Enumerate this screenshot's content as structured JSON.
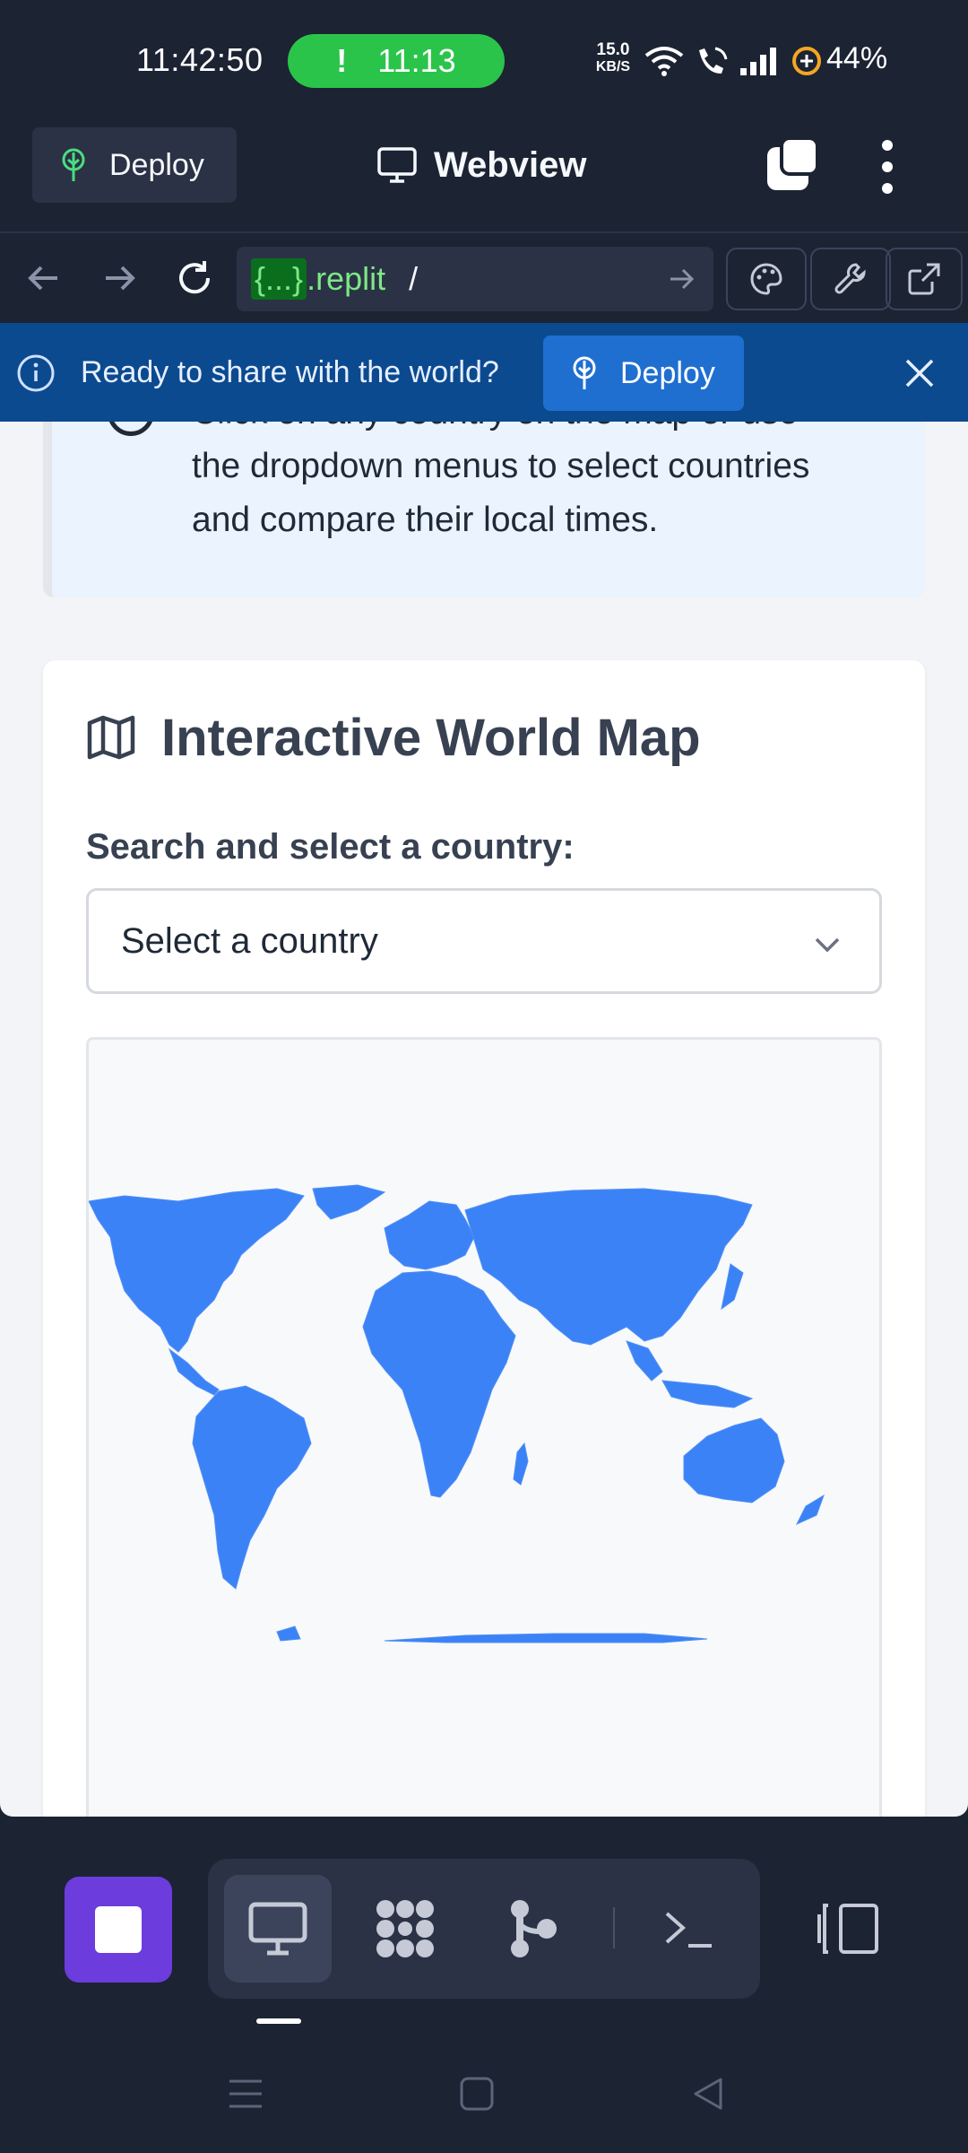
{
  "status_bar": {
    "time": "11:42:50",
    "call_timer": "11:13",
    "call_alert": "!",
    "net_speed_value": "15.0",
    "net_speed_unit": "KB/S",
    "battery_percent": "44%"
  },
  "app_header": {
    "deploy_label": "Deploy",
    "title": "Webview"
  },
  "browser": {
    "url_host": "{...}",
    "url_domain": ".replit",
    "url_path": "/"
  },
  "banner": {
    "message": "Ready to share with the world?",
    "deploy_label": "Deploy"
  },
  "page": {
    "instructions_line1": "Click on any country on the map or use",
    "instructions_line2": "the dropdown menus to select countries",
    "instructions_line3": "and compare their local times.",
    "map_title": "Interactive World Map",
    "search_label": "Search and select a country:",
    "select_value": "Select a country"
  },
  "colors": {
    "map_fill": "#3b82f6",
    "banner_bg": "#0c4a8f",
    "stop_button": "#6c3cdc",
    "call_pill": "#2bc44a"
  },
  "icons": {
    "deploy": "deploy-tree-icon",
    "webview": "monitor-icon",
    "tabs": "tabs-icon",
    "menu": "kebab-menu-icon",
    "back": "arrow-left-icon",
    "forward": "arrow-right-icon",
    "reload": "reload-icon",
    "go": "arrow-right-icon",
    "palette": "palette-icon",
    "devtools": "wrench-icon",
    "open_external": "external-link-icon",
    "info": "info-icon",
    "close": "close-icon",
    "map": "map-icon",
    "chevron": "chevron-down-icon",
    "stop": "stop-icon",
    "webview_pane": "monitor-icon",
    "packages": "packages-icon",
    "git": "git-icon",
    "shell": "terminal-icon",
    "layout": "layout-icon"
  }
}
